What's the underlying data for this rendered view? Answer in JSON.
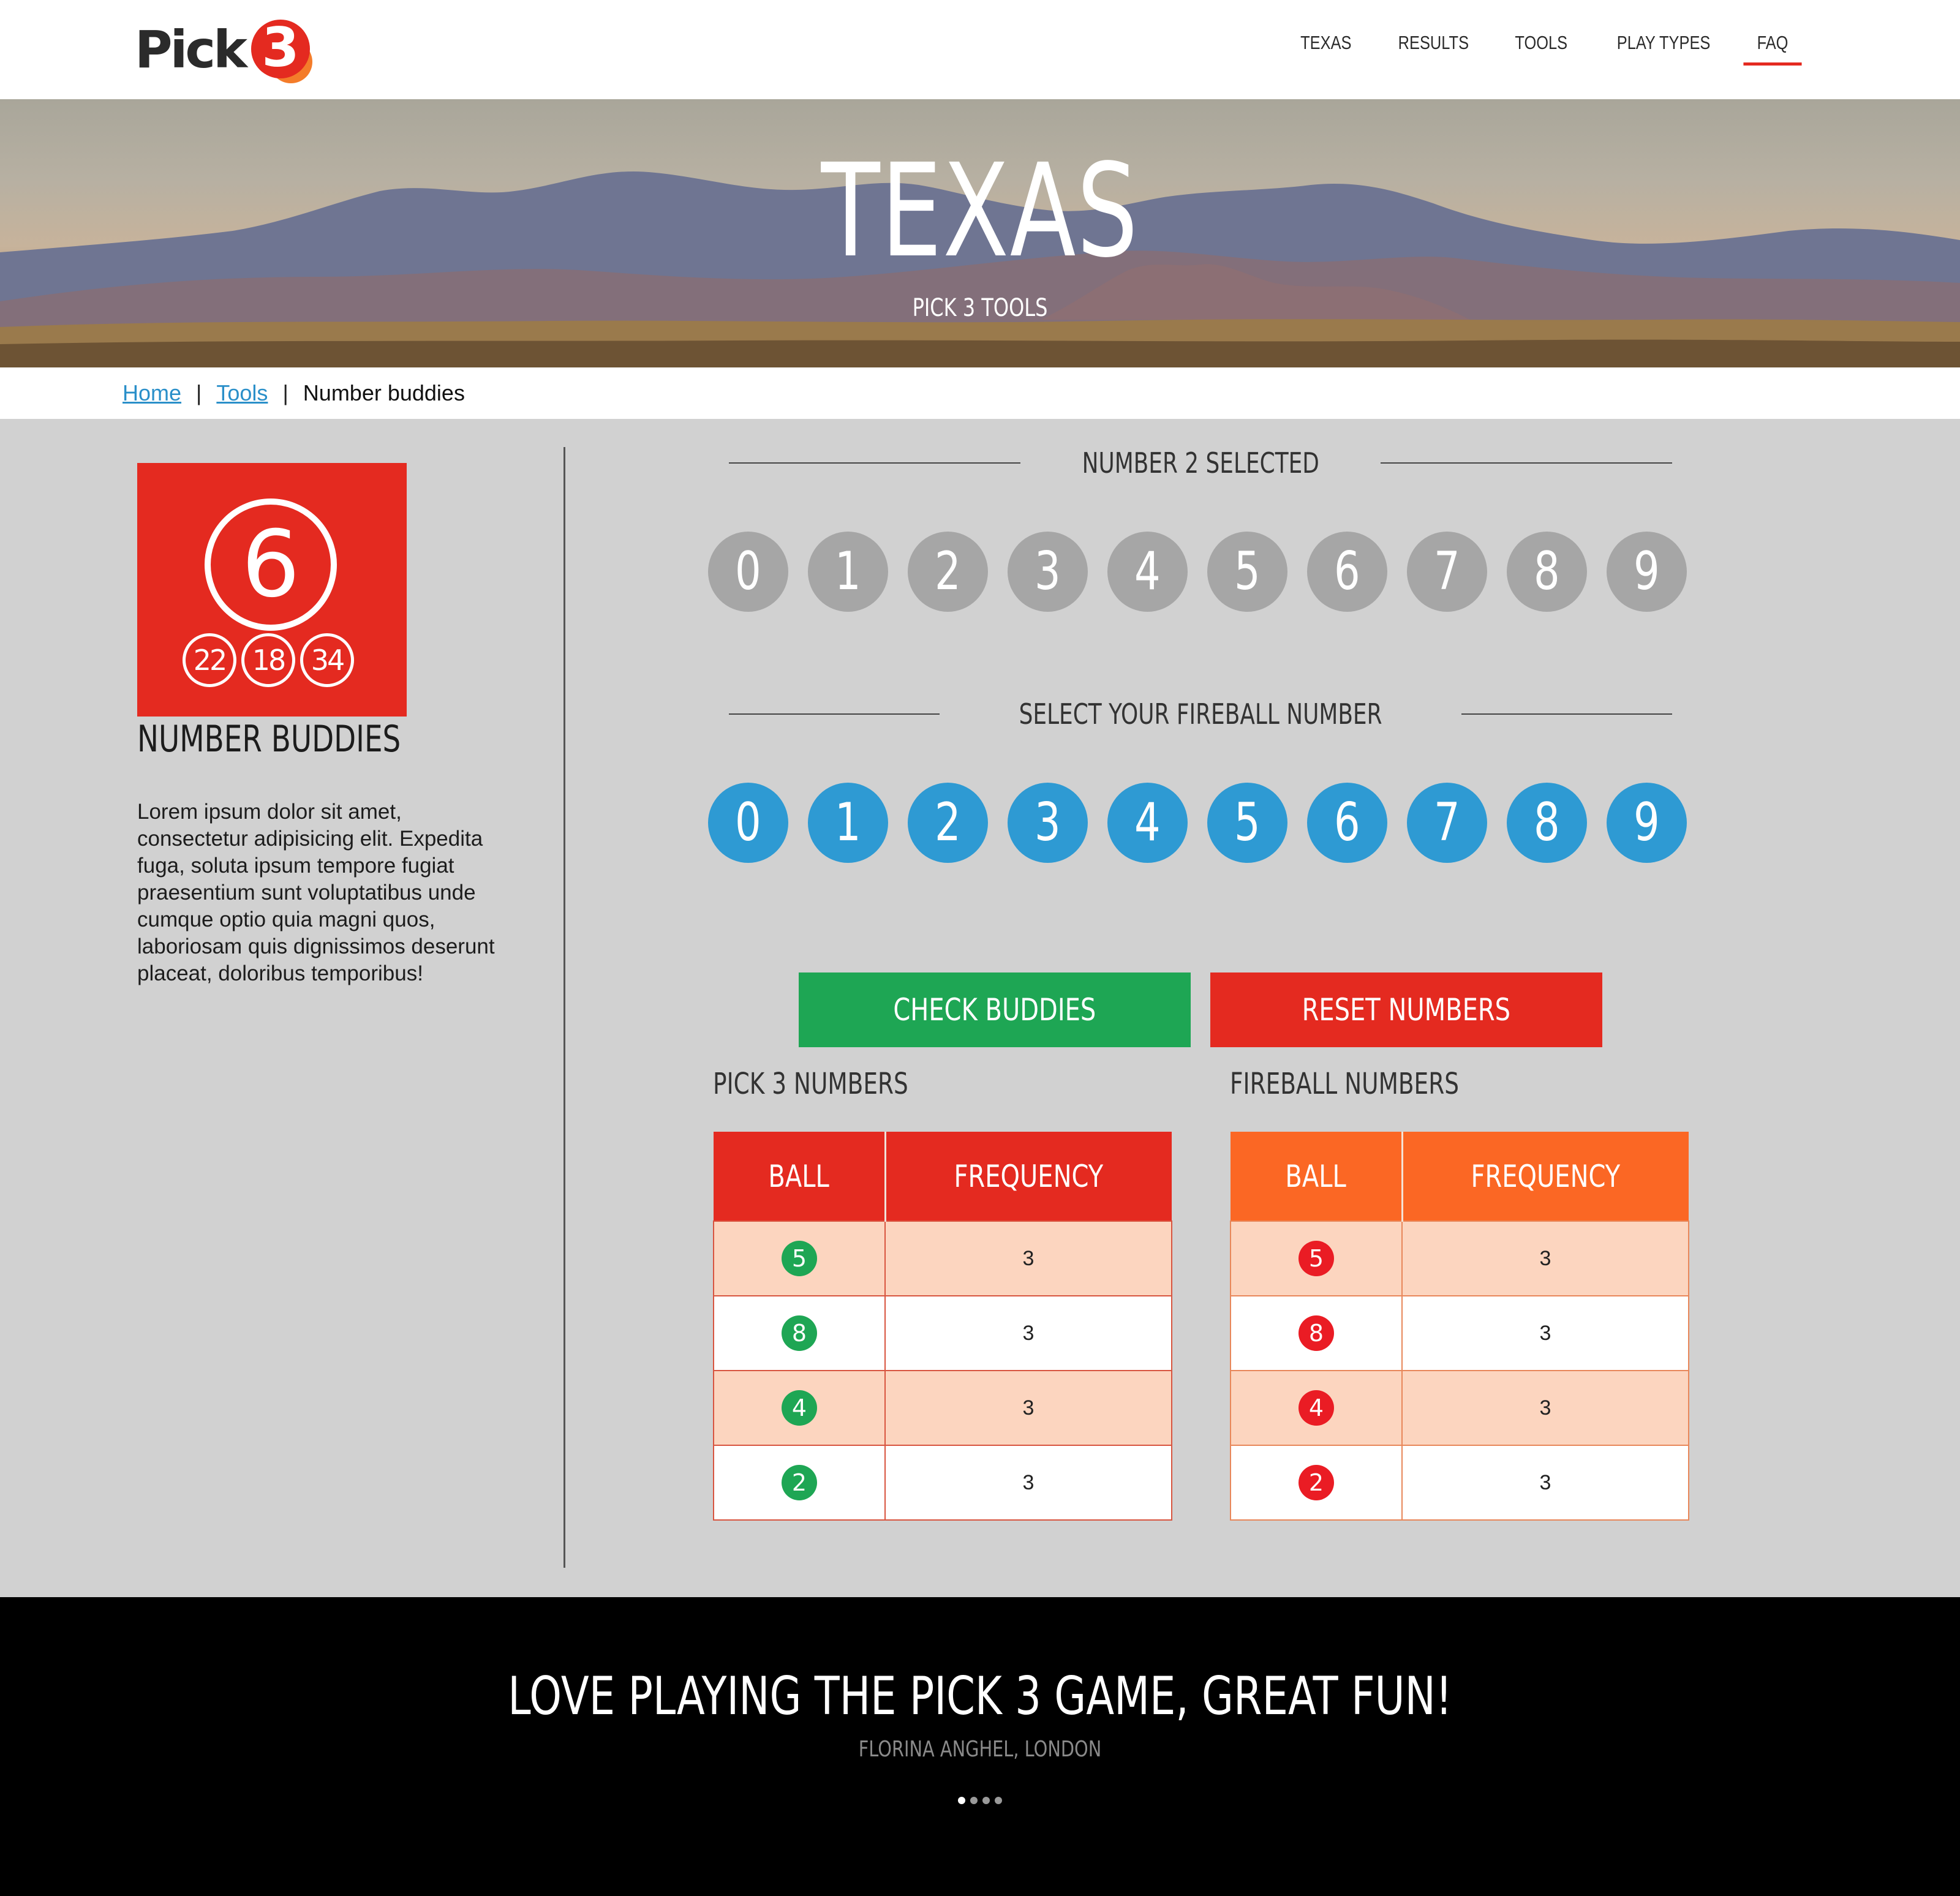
{
  "brand": {
    "word": "Pick",
    "digit": "3"
  },
  "nav": {
    "items": [
      {
        "label": "TEXAS",
        "active": false
      },
      {
        "label": "RESULTS",
        "active": false
      },
      {
        "label": "TOOLS",
        "active": false
      },
      {
        "label": "PLAY TYPES",
        "active": false
      },
      {
        "label": "FAQ",
        "active": true
      }
    ]
  },
  "hero": {
    "title": "TEXAS",
    "subtitle": "PICK 3 TOOLS"
  },
  "breadcrumb": {
    "home": "Home",
    "tools": "Tools",
    "current": "Number buddies"
  },
  "tool": {
    "icon_main": "6",
    "icon_small": [
      "22",
      "18",
      "34"
    ],
    "title": "NUMBER BUDDIES",
    "description": "Lorem ipsum dolor sit amet, consectetur adipisicing elit. Expedita fuga, soluta ipsum tempore fugiat praesentium sunt voluptatibus unde cumque optio quia magni quos, laboriosam quis dignissimos deserunt placeat, doloribus temporibus!"
  },
  "selector": {
    "number_heading": "NUMBER 2 SELECTED",
    "numbers": [
      "0",
      "1",
      "2",
      "3",
      "4",
      "5",
      "6",
      "7",
      "8",
      "9"
    ],
    "fireball_heading": "SELECT YOUR FIREBALL NUMBER",
    "fireball_numbers": [
      "0",
      "1",
      "2",
      "3",
      "4",
      "5",
      "6",
      "7",
      "8",
      "9"
    ]
  },
  "buttons": {
    "check": "CHECK BUDDIES",
    "reset": "RESET NUMBERS"
  },
  "pick3_table": {
    "title": "PICK 3 NUMBERS",
    "headers": [
      "BALL",
      "FREQUENCY"
    ],
    "rows": [
      {
        "ball": "5",
        "frequency": "3"
      },
      {
        "ball": "8",
        "frequency": "3"
      },
      {
        "ball": "4",
        "frequency": "3"
      },
      {
        "ball": "2",
        "frequency": "3"
      }
    ]
  },
  "fireball_table": {
    "title": "FIREBALL NUMBERS",
    "headers": [
      "BALL",
      "FREQUENCY"
    ],
    "rows": [
      {
        "ball": "5",
        "frequency": "3"
      },
      {
        "ball": "8",
        "frequency": "3"
      },
      {
        "ball": "4",
        "frequency": "3"
      },
      {
        "ball": "2",
        "frequency": "3"
      }
    ]
  },
  "testimonial": {
    "quote": "LOVE PLAYING THE PICK 3 GAME, GREAT FUN!",
    "author": "FLORINA ANGHEL, LONDON",
    "dots": 4,
    "active_dot": 0
  },
  "colors": {
    "brand_red": "#e42a20",
    "brand_orange": "#fb6724",
    "ball_grey": "#a6a6a6",
    "ball_blue": "#2e9ad3",
    "button_green": "#1ea654",
    "row_peach": "#fcd5bf"
  }
}
